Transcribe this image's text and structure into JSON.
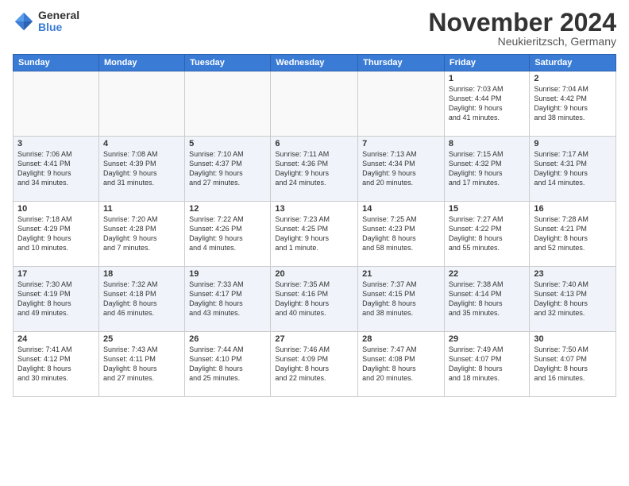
{
  "logo": {
    "general": "General",
    "blue": "Blue"
  },
  "title": "November 2024",
  "location": "Neukieritzsch, Germany",
  "days_header": [
    "Sunday",
    "Monday",
    "Tuesday",
    "Wednesday",
    "Thursday",
    "Friday",
    "Saturday"
  ],
  "weeks": [
    [
      {
        "day": "",
        "info": ""
      },
      {
        "day": "",
        "info": ""
      },
      {
        "day": "",
        "info": ""
      },
      {
        "day": "",
        "info": ""
      },
      {
        "day": "",
        "info": ""
      },
      {
        "day": "1",
        "info": "Sunrise: 7:03 AM\nSunset: 4:44 PM\nDaylight: 9 hours\nand 41 minutes."
      },
      {
        "day": "2",
        "info": "Sunrise: 7:04 AM\nSunset: 4:42 PM\nDaylight: 9 hours\nand 38 minutes."
      }
    ],
    [
      {
        "day": "3",
        "info": "Sunrise: 7:06 AM\nSunset: 4:41 PM\nDaylight: 9 hours\nand 34 minutes."
      },
      {
        "day": "4",
        "info": "Sunrise: 7:08 AM\nSunset: 4:39 PM\nDaylight: 9 hours\nand 31 minutes."
      },
      {
        "day": "5",
        "info": "Sunrise: 7:10 AM\nSunset: 4:37 PM\nDaylight: 9 hours\nand 27 minutes."
      },
      {
        "day": "6",
        "info": "Sunrise: 7:11 AM\nSunset: 4:36 PM\nDaylight: 9 hours\nand 24 minutes."
      },
      {
        "day": "7",
        "info": "Sunrise: 7:13 AM\nSunset: 4:34 PM\nDaylight: 9 hours\nand 20 minutes."
      },
      {
        "day": "8",
        "info": "Sunrise: 7:15 AM\nSunset: 4:32 PM\nDaylight: 9 hours\nand 17 minutes."
      },
      {
        "day": "9",
        "info": "Sunrise: 7:17 AM\nSunset: 4:31 PM\nDaylight: 9 hours\nand 14 minutes."
      }
    ],
    [
      {
        "day": "10",
        "info": "Sunrise: 7:18 AM\nSunset: 4:29 PM\nDaylight: 9 hours\nand 10 minutes."
      },
      {
        "day": "11",
        "info": "Sunrise: 7:20 AM\nSunset: 4:28 PM\nDaylight: 9 hours\nand 7 minutes."
      },
      {
        "day": "12",
        "info": "Sunrise: 7:22 AM\nSunset: 4:26 PM\nDaylight: 9 hours\nand 4 minutes."
      },
      {
        "day": "13",
        "info": "Sunrise: 7:23 AM\nSunset: 4:25 PM\nDaylight: 9 hours\nand 1 minute."
      },
      {
        "day": "14",
        "info": "Sunrise: 7:25 AM\nSunset: 4:23 PM\nDaylight: 8 hours\nand 58 minutes."
      },
      {
        "day": "15",
        "info": "Sunrise: 7:27 AM\nSunset: 4:22 PM\nDaylight: 8 hours\nand 55 minutes."
      },
      {
        "day": "16",
        "info": "Sunrise: 7:28 AM\nSunset: 4:21 PM\nDaylight: 8 hours\nand 52 minutes."
      }
    ],
    [
      {
        "day": "17",
        "info": "Sunrise: 7:30 AM\nSunset: 4:19 PM\nDaylight: 8 hours\nand 49 minutes."
      },
      {
        "day": "18",
        "info": "Sunrise: 7:32 AM\nSunset: 4:18 PM\nDaylight: 8 hours\nand 46 minutes."
      },
      {
        "day": "19",
        "info": "Sunrise: 7:33 AM\nSunset: 4:17 PM\nDaylight: 8 hours\nand 43 minutes."
      },
      {
        "day": "20",
        "info": "Sunrise: 7:35 AM\nSunset: 4:16 PM\nDaylight: 8 hours\nand 40 minutes."
      },
      {
        "day": "21",
        "info": "Sunrise: 7:37 AM\nSunset: 4:15 PM\nDaylight: 8 hours\nand 38 minutes."
      },
      {
        "day": "22",
        "info": "Sunrise: 7:38 AM\nSunset: 4:14 PM\nDaylight: 8 hours\nand 35 minutes."
      },
      {
        "day": "23",
        "info": "Sunrise: 7:40 AM\nSunset: 4:13 PM\nDaylight: 8 hours\nand 32 minutes."
      }
    ],
    [
      {
        "day": "24",
        "info": "Sunrise: 7:41 AM\nSunset: 4:12 PM\nDaylight: 8 hours\nand 30 minutes."
      },
      {
        "day": "25",
        "info": "Sunrise: 7:43 AM\nSunset: 4:11 PM\nDaylight: 8 hours\nand 27 minutes."
      },
      {
        "day": "26",
        "info": "Sunrise: 7:44 AM\nSunset: 4:10 PM\nDaylight: 8 hours\nand 25 minutes."
      },
      {
        "day": "27",
        "info": "Sunrise: 7:46 AM\nSunset: 4:09 PM\nDaylight: 8 hours\nand 22 minutes."
      },
      {
        "day": "28",
        "info": "Sunrise: 7:47 AM\nSunset: 4:08 PM\nDaylight: 8 hours\nand 20 minutes."
      },
      {
        "day": "29",
        "info": "Sunrise: 7:49 AM\nSunset: 4:07 PM\nDaylight: 8 hours\nand 18 minutes."
      },
      {
        "day": "30",
        "info": "Sunrise: 7:50 AM\nSunset: 4:07 PM\nDaylight: 8 hours\nand 16 minutes."
      }
    ]
  ]
}
